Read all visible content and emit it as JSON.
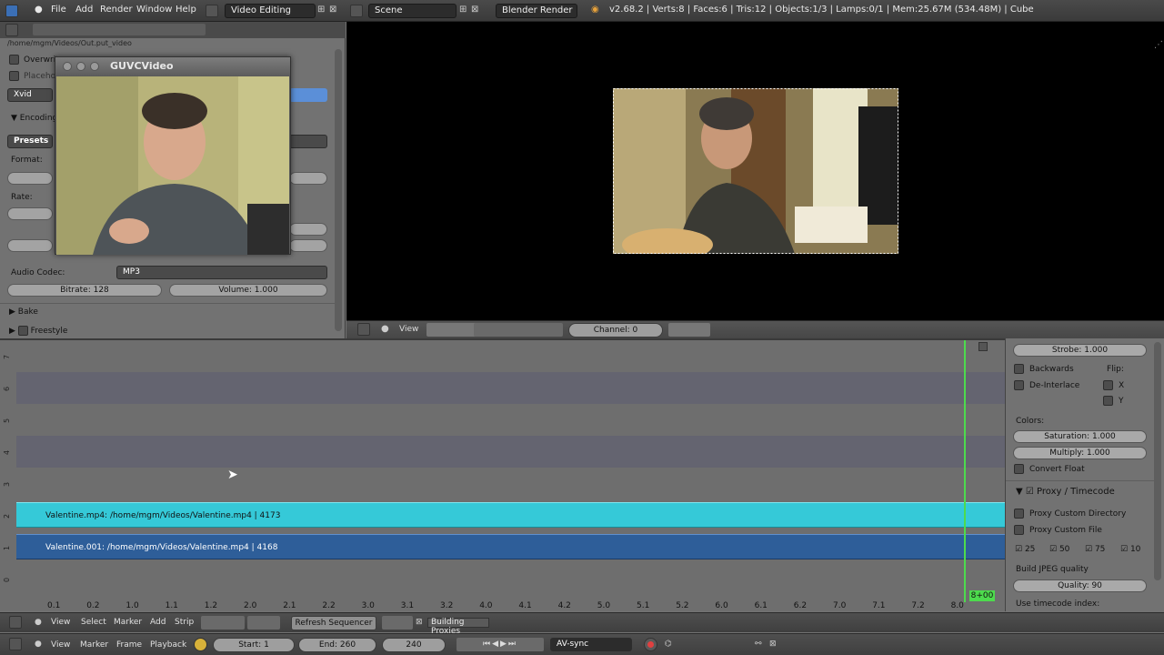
{
  "topbar": {
    "menus": [
      "File",
      "Add",
      "Render",
      "Window",
      "Help"
    ],
    "screen_layout": "Video Editing",
    "scene": "Scene",
    "render_engine": "Blender Render",
    "stats": "v2.68.2 | Verts:8 | Faces:6 | Tris:12 | Objects:1/3 | Lamps:0/1 | Mem:25.67M (534.48M) | Cube"
  },
  "props": {
    "path": "/home/mgm/Videos/Out.put_video",
    "overwrite": "Overwrit",
    "placeholders": "Placeho",
    "format_value": "Xvid",
    "encoding_label": "Encoding",
    "presets_label": "Presets",
    "format_label": "Format:",
    "rate_label": "Rate:",
    "audio_codec_label": "Audio Codec:",
    "audio_codec_value": "MP3",
    "bitrate": "Bitrate: 128",
    "volume": "Volume: 1.000",
    "bake": "Bake",
    "freestyle": "Freestyle"
  },
  "guvc": {
    "title": "GUVCVideo"
  },
  "preview_header": {
    "view": "View",
    "channel": "Channel: 0"
  },
  "sequencer": {
    "channel_numbers": [
      "7",
      "6",
      "5",
      "4",
      "3",
      "2",
      "1",
      "0"
    ],
    "strip_top": "Valentine.mp4: /home/mgm/Videos/Valentine.mp4 | 4173",
    "strip_bottom": "Valentine.001: /home/mgm/Videos/Valentine.mp4 | 4168",
    "time_ticks": [
      "0.1",
      "0.2",
      "1.0",
      "1.1",
      "1.2",
      "2.0",
      "2.1",
      "2.2",
      "3.0",
      "3.1",
      "3.2",
      "4.0",
      "4.1",
      "4.2",
      "5.0",
      "5.1",
      "5.2",
      "6.0",
      "6.1",
      "6.2",
      "7.0",
      "7.1",
      "7.2",
      "8.0"
    ],
    "playhead_label": "8+00"
  },
  "rpanel": {
    "strobe": "Strobe: 1.000",
    "backwards": "Backwards",
    "flip_label": "Flip:",
    "deinterlace": "De-Interlace",
    "flip_x": "X",
    "flip_y": "Y",
    "colors_label": "Colors:",
    "saturation": "Saturation: 1.000",
    "multiply": "Multiply: 1.000",
    "convert_float": "Convert Float",
    "proxy_timecode": "Proxy / Timecode",
    "proxy_custom_dir": "Proxy Custom Directory",
    "proxy_custom_file": "Proxy Custom File",
    "sizes": [
      "25",
      "50",
      "75",
      "10"
    ],
    "build_jpeg": "Build JPEG quality",
    "quality": "Quality: 90",
    "use_timecode": "Use timecode index:"
  },
  "seq_header": {
    "menus": [
      "View",
      "Select",
      "Marker",
      "Add",
      "Strip"
    ],
    "refresh": "Refresh Sequencer",
    "building": "Building Proxies"
  },
  "timeline": {
    "menus": [
      "View",
      "Marker",
      "Frame",
      "Playback"
    ],
    "start": "Start: 1",
    "end": "End: 260",
    "current": "240",
    "sync": "AV-sync"
  },
  "colors": {
    "strip_top": "#35c9d8",
    "strip_bottom": "#2e5e99",
    "playhead": "#4ddb4d"
  }
}
